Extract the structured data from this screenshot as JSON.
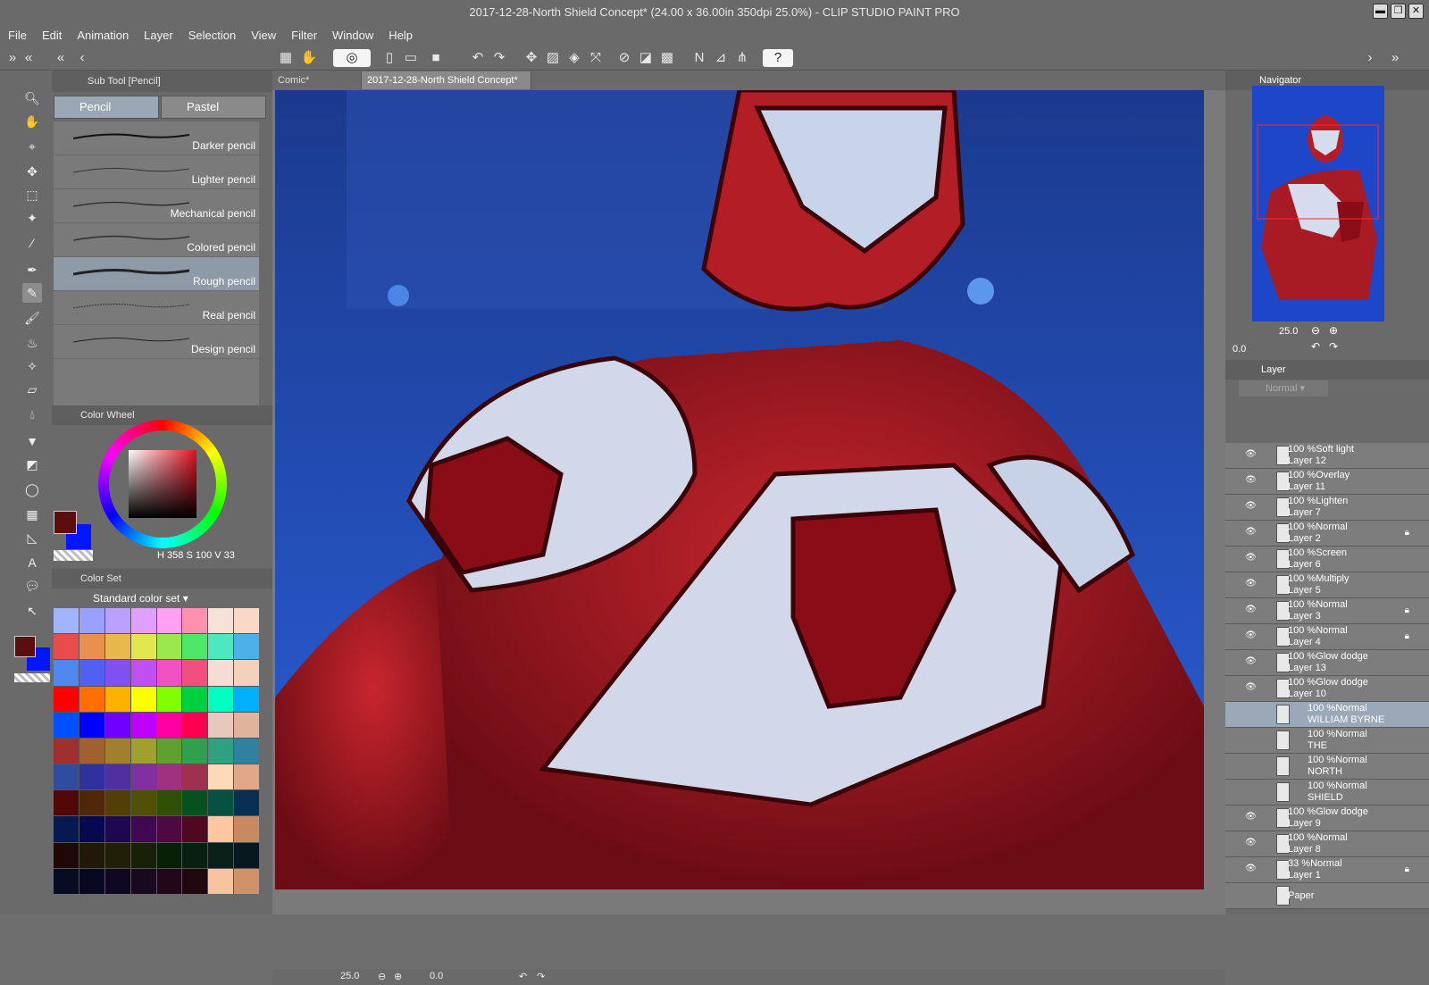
{
  "window": {
    "title": "2017-12-28-North Shield Concept* (24.00 x 36.00in 350dpi 25.0%)  - CLIP STUDIO PAINT PRO"
  },
  "menu": [
    "File",
    "Edit",
    "Animation",
    "Layer",
    "Selection",
    "View",
    "Filter",
    "Window",
    "Help"
  ],
  "subtool": {
    "header": "Sub Tool [Pencil]",
    "tabs": [
      "Pencil",
      "Pastel"
    ],
    "pencils": [
      "Darker pencil",
      "Lighter pencil",
      "Mechanical pencil",
      "Colored pencil",
      "Rough pencil",
      "Real pencil",
      "Design pencil"
    ],
    "selected_index": 4
  },
  "color_wheel": {
    "header": "Color Wheel",
    "h_label": "H",
    "h": "358",
    "s_label": "S",
    "s": "100",
    "v_label": "V",
    "v": "33",
    "main_color": "#5c0d0d",
    "sub_color": "#0016ff"
  },
  "color_set": {
    "header": "Color Set",
    "set_name": "Standard color set",
    "colors": [
      "#a0b4ff",
      "#9aa0ff",
      "#bba0ff",
      "#e0a0ff",
      "#ffa0f0",
      "#ff90b0",
      "#f8e2d8",
      "#f9d8c6",
      "#e84d4d",
      "#e8904d",
      "#e8b84d",
      "#e0e84d",
      "#9ae84d",
      "#4de86a",
      "#4de8c0",
      "#4db0e8",
      "#5088f0",
      "#5060f0",
      "#8050f0",
      "#c050f0",
      "#f050c0",
      "#f05080",
      "#f6dcd2",
      "#f5d0bc",
      "#ff0000",
      "#ff7000",
      "#ffb000",
      "#ffff00",
      "#80ff00",
      "#00d040",
      "#00ffc0",
      "#00b0ff",
      "#0050ff",
      "#0000ff",
      "#7000ff",
      "#c000ff",
      "#ff00a0",
      "#ff0050",
      "#e8c8bc",
      "#e0b49c",
      "#a03030",
      "#a06030",
      "#a08030",
      "#a0a030",
      "#60a030",
      "#30a050",
      "#30a080",
      "#3080a0",
      "#304ca0",
      "#3030a0",
      "#5030a0",
      "#8030a0",
      "#a03080",
      "#a03050",
      "#ffd8b8",
      "#e0a888",
      "#500808",
      "#502808",
      "#504008",
      "#505008",
      "#305008",
      "#085020",
      "#085040",
      "#083050",
      "#081850",
      "#080850",
      "#200850",
      "#400850",
      "#500840",
      "#500820",
      "#ffc8a0",
      "#c88860",
      "#200808",
      "#201808",
      "#202008",
      "#182008",
      "#082008",
      "#082010",
      "#082018",
      "#081820",
      "#080c20",
      "#080820",
      "#100820",
      "#180820",
      "#200818",
      "#200810",
      "#f8c4a0",
      "#d09068"
    ]
  },
  "canvas": {
    "tabs": [
      "Comic*",
      "2017-12-28-North Shield Concept*"
    ],
    "zoom": "25.0",
    "rotation": "0.0"
  },
  "navigator": {
    "header": "Navigator",
    "zoom": "25.0",
    "rotation": "0.0"
  },
  "layer_panel": {
    "header": "Layer",
    "blend_mode": "Normal",
    "layers": [
      {
        "mode": "100 %Soft light",
        "name": "Layer 12",
        "visible": true,
        "locked": false,
        "text": false
      },
      {
        "mode": "100 %Overlay",
        "name": "Layer 11",
        "visible": true,
        "locked": false,
        "text": false
      },
      {
        "mode": "100 %Lighten",
        "name": "Layer 7",
        "visible": true,
        "locked": false,
        "text": false
      },
      {
        "mode": "100 %Normal",
        "name": "Layer 2",
        "visible": true,
        "locked": true,
        "text": false
      },
      {
        "mode": "100 %Screen",
        "name": "Layer 6",
        "visible": true,
        "locked": false,
        "text": false
      },
      {
        "mode": "100 %Multiply",
        "name": "Layer 5",
        "visible": true,
        "locked": false,
        "text": false
      },
      {
        "mode": "100 %Normal",
        "name": "Layer 3",
        "visible": true,
        "locked": true,
        "text": false
      },
      {
        "mode": "100 %Normal",
        "name": "Layer 4",
        "visible": true,
        "locked": true,
        "text": false
      },
      {
        "mode": "100 %Glow dodge",
        "name": "Layer 13",
        "visible": true,
        "locked": false,
        "text": false
      },
      {
        "mode": "100 %Glow dodge",
        "name": "Layer 10",
        "visible": true,
        "locked": false,
        "text": false
      },
      {
        "mode": "100 %Normal",
        "name": "WILLIAM BYRNE",
        "visible": false,
        "locked": false,
        "text": true,
        "selected": true
      },
      {
        "mode": "100 %Normal",
        "name": "THE",
        "visible": false,
        "locked": false,
        "text": true
      },
      {
        "mode": "100 %Normal",
        "name": "NORTH",
        "visible": false,
        "locked": false,
        "text": true
      },
      {
        "mode": "100 %Normal",
        "name": "SHIELD",
        "visible": false,
        "locked": false,
        "text": true
      },
      {
        "mode": "100 %Glow dodge",
        "name": "Layer 9",
        "visible": true,
        "locked": false,
        "text": false
      },
      {
        "mode": "100 %Normal",
        "name": "Layer 8",
        "visible": true,
        "locked": false,
        "text": false
      },
      {
        "mode": "33 %Normal",
        "name": "Layer 1",
        "visible": true,
        "locked": true,
        "text": false
      },
      {
        "mode": "",
        "name": "Paper",
        "visible": false,
        "locked": false,
        "text": false
      }
    ]
  }
}
